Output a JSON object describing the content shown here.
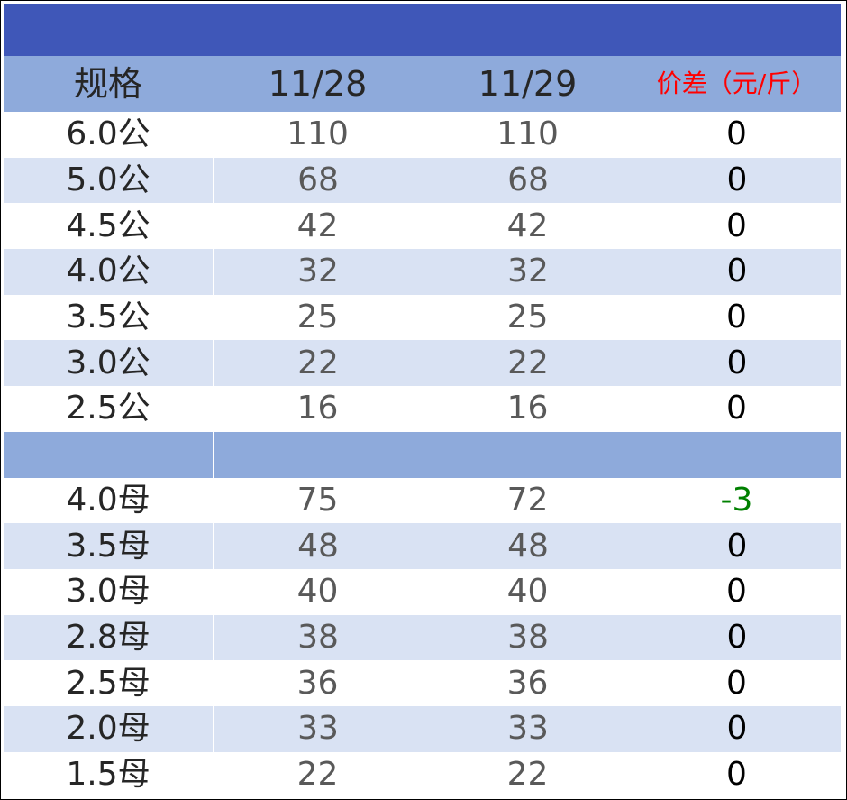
{
  "title": "",
  "header": {
    "spec": "规格",
    "date1": "11/28",
    "date2": "11/29",
    "diff": "价差（元/斤）"
  },
  "colors": {
    "title_bar": "#3f57b8",
    "header_bg": "#8eaadb",
    "alt_row_bg": "#d9e2f3",
    "diff_header": "#ff0000",
    "negative": "#008000"
  },
  "male_rows": [
    {
      "spec": "6.0公",
      "d1": "110",
      "d2": "110",
      "diff": "0"
    },
    {
      "spec": "5.0公",
      "d1": "68",
      "d2": "68",
      "diff": "0"
    },
    {
      "spec": "4.5公",
      "d1": "42",
      "d2": "42",
      "diff": "0"
    },
    {
      "spec": "4.0公",
      "d1": "32",
      "d2": "32",
      "diff": "0"
    },
    {
      "spec": "3.5公",
      "d1": "25",
      "d2": "25",
      "diff": "0"
    },
    {
      "spec": "3.0公",
      "d1": "22",
      "d2": "22",
      "diff": "0"
    },
    {
      "spec": "2.5公",
      "d1": "16",
      "d2": "16",
      "diff": "0"
    }
  ],
  "female_rows": [
    {
      "spec": "4.0母",
      "d1": "75",
      "d2": "72",
      "diff": "-3"
    },
    {
      "spec": "3.5母",
      "d1": "48",
      "d2": "48",
      "diff": "0"
    },
    {
      "spec": "3.0母",
      "d1": "40",
      "d2": "40",
      "diff": "0"
    },
    {
      "spec": "2.8母",
      "d1": "38",
      "d2": "38",
      "diff": "0"
    },
    {
      "spec": "2.5母",
      "d1": "36",
      "d2": "36",
      "diff": "0"
    },
    {
      "spec": "2.0母",
      "d1": "33",
      "d2": "33",
      "diff": "0"
    },
    {
      "spec": "1.5母",
      "d1": "22",
      "d2": "22",
      "diff": "0"
    }
  ]
}
